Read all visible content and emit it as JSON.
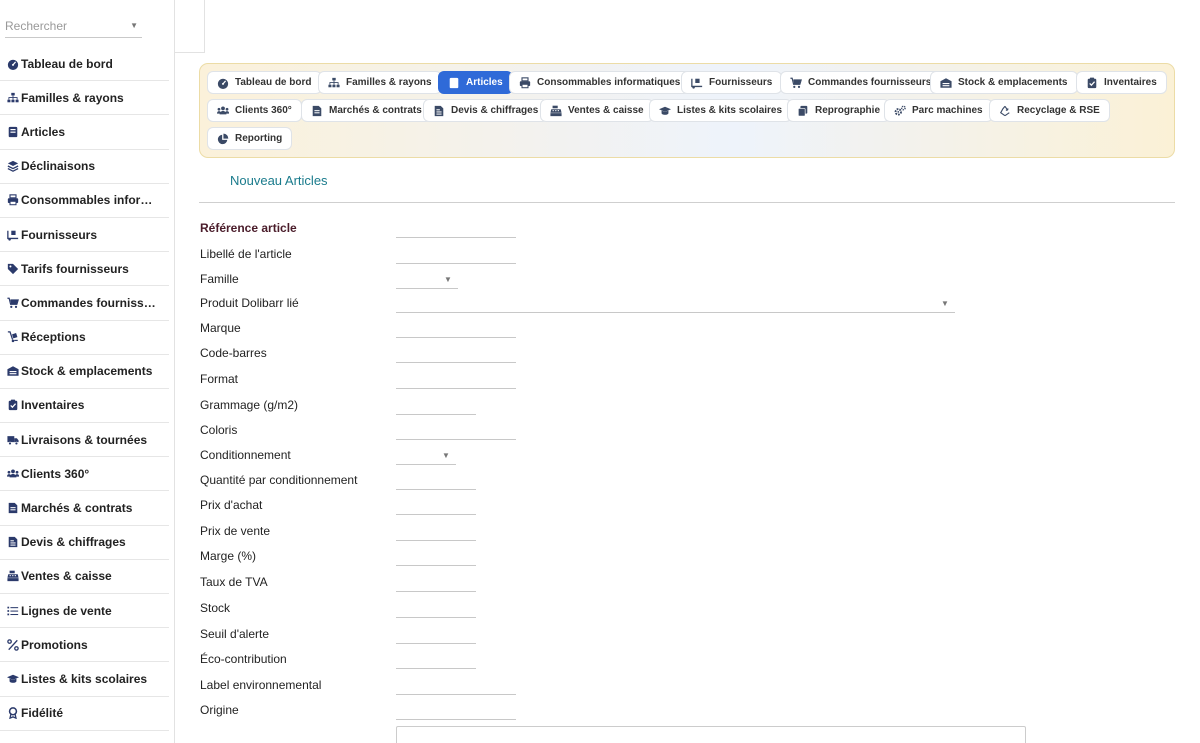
{
  "search": {
    "placeholder": "Rechercher"
  },
  "sidebar": {
    "items": [
      {
        "label": "Tableau de bord",
        "icon": "gauge-icon"
      },
      {
        "label": "Familles & rayons",
        "icon": "sitemap-icon"
      },
      {
        "label": "Articles",
        "icon": "book-icon"
      },
      {
        "label": "Déclinaisons",
        "icon": "layers-icon"
      },
      {
        "label": "Consommables informatiques",
        "icon": "printer-icon"
      },
      {
        "label": "Fournisseurs",
        "icon": "truck-loading-icon"
      },
      {
        "label": "Tarifs fournisseurs",
        "icon": "tags-icon"
      },
      {
        "label": "Commandes fournisseurs",
        "icon": "cart-icon"
      },
      {
        "label": "Réceptions",
        "icon": "dolly-icon"
      },
      {
        "label": "Stock & emplacements",
        "icon": "warehouse-icon"
      },
      {
        "label": "Inventaires",
        "icon": "clipboard-check-icon"
      },
      {
        "label": "Livraisons & tournées",
        "icon": "truck-icon"
      },
      {
        "label": "Clients 360°",
        "icon": "users-icon"
      },
      {
        "label": "Marchés & contrats",
        "icon": "contract-icon"
      },
      {
        "label": "Devis & chiffrages",
        "icon": "invoice-icon"
      },
      {
        "label": "Ventes & caisse",
        "icon": "cash-register-icon"
      },
      {
        "label": "Lignes de vente",
        "icon": "list-icon"
      },
      {
        "label": "Promotions",
        "icon": "percent-icon"
      },
      {
        "label": "Listes & kits scolaires",
        "icon": "graduation-cap-icon"
      },
      {
        "label": "Fidélité",
        "icon": "award-icon"
      }
    ]
  },
  "nav": {
    "chips": [
      {
        "label": "Tableau de bord",
        "icon": "gauge-icon",
        "active": false
      },
      {
        "label": "Familles & rayons",
        "icon": "sitemap-icon",
        "active": false
      },
      {
        "label": "Articles",
        "icon": "book-icon",
        "active": true
      },
      {
        "label": "Consommables informatiques",
        "icon": "printer-icon",
        "active": false
      },
      {
        "label": "Fournisseurs",
        "icon": "truck-loading-icon",
        "active": false
      },
      {
        "label": "Commandes fournisseurs",
        "icon": "cart-icon",
        "active": false
      },
      {
        "label": "Stock & emplacements",
        "icon": "warehouse-icon",
        "active": false
      },
      {
        "label": "Inventaires",
        "icon": "clipboard-check-icon",
        "active": false
      },
      {
        "label": "Clients 360°",
        "icon": "users-icon",
        "active": false
      },
      {
        "label": "Marchés & contrats",
        "icon": "contract-icon",
        "active": false
      },
      {
        "label": "Devis & chiffrages",
        "icon": "invoice-icon",
        "active": false
      },
      {
        "label": "Ventes & caisse",
        "icon": "cash-register-icon",
        "active": false
      },
      {
        "label": "Listes & kits scolaires",
        "icon": "graduation-cap-icon",
        "active": false
      },
      {
        "label": "Reprographie",
        "icon": "copy-icon",
        "active": false
      },
      {
        "label": "Parc machines",
        "icon": "cogs-icon",
        "active": false
      },
      {
        "label": "Recyclage & RSE",
        "icon": "recycle-icon",
        "active": false
      },
      {
        "label": "Reporting",
        "icon": "pie-chart-icon",
        "active": false
      }
    ]
  },
  "form": {
    "title": "Nouveau Articles",
    "fields": [
      {
        "label": "Référence article",
        "value": "",
        "required": true
      },
      {
        "label": "Libellé de l'article",
        "value": ""
      },
      {
        "label": "Famille",
        "value": "",
        "type": "select"
      },
      {
        "label": "Produit Dolibarr lié",
        "value": "",
        "type": "select"
      },
      {
        "label": "Marque",
        "value": ""
      },
      {
        "label": "Code-barres",
        "value": ""
      },
      {
        "label": "Format",
        "value": ""
      },
      {
        "label": "Grammage (g/m2)",
        "value": ""
      },
      {
        "label": "Coloris",
        "value": ""
      },
      {
        "label": "Conditionnement",
        "value": "",
        "type": "select"
      },
      {
        "label": "Quantité par conditionnement",
        "value": ""
      },
      {
        "label": "Prix d'achat",
        "value": ""
      },
      {
        "label": "Prix de vente",
        "value": ""
      },
      {
        "label": "Marge (%)",
        "value": ""
      },
      {
        "label": "Taux de TVA",
        "value": ""
      },
      {
        "label": "Stock",
        "value": ""
      },
      {
        "label": "Seuil d'alerte",
        "value": ""
      },
      {
        "label": "Éco-contribution",
        "value": ""
      },
      {
        "label": "Label environnemental",
        "value": ""
      },
      {
        "label": "Origine",
        "value": ""
      }
    ]
  },
  "colors": {
    "accent": "#2f6ad8",
    "title": "#1a7b8c",
    "required_label": "#4a1c2a"
  }
}
